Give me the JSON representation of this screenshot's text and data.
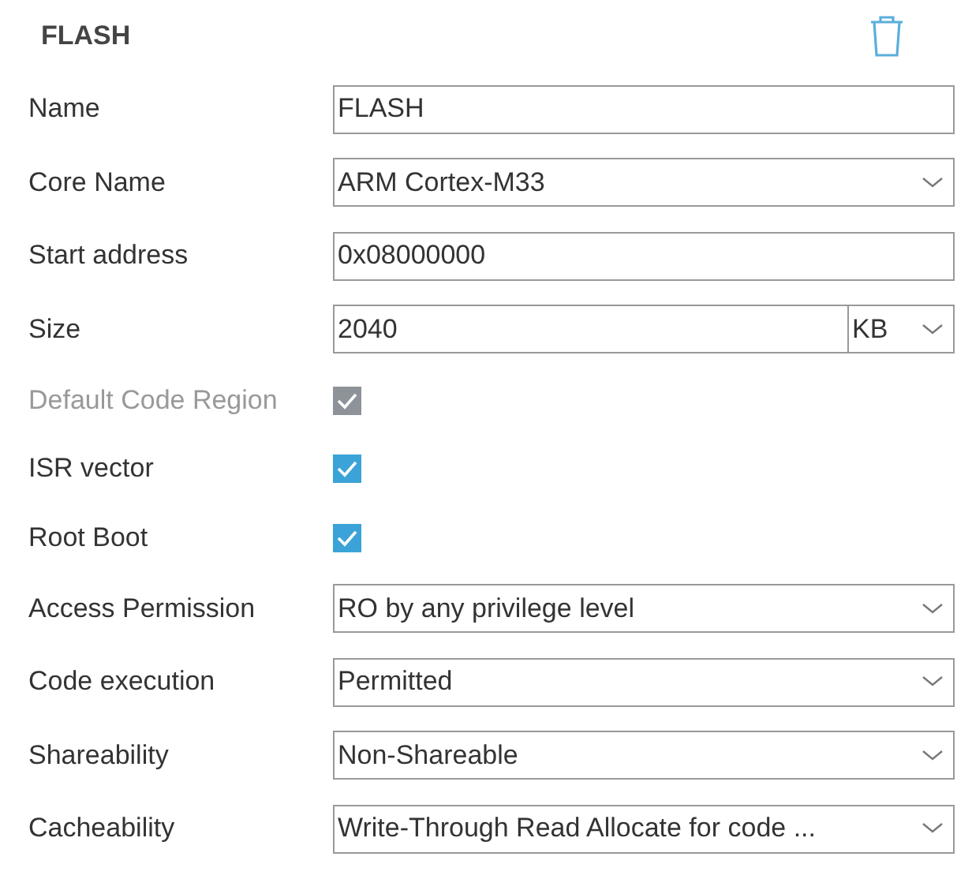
{
  "panel": {
    "title": "FLASH"
  },
  "fields": [
    {
      "kind": "text",
      "label": "Name",
      "value": "FLASH"
    },
    {
      "kind": "select",
      "label": "Core Name",
      "value": "ARM Cortex-M33"
    },
    {
      "kind": "text",
      "label": "Start address",
      "value": "0x08000000"
    },
    {
      "kind": "size",
      "label": "Size",
      "value": "2040",
      "unit": "KB"
    },
    {
      "kind": "checkbox",
      "label": "Default Code Region",
      "checked": true,
      "disabled": true
    },
    {
      "kind": "checkbox",
      "label": "ISR vector",
      "checked": true,
      "disabled": false
    },
    {
      "kind": "checkbox",
      "label": "Root Boot",
      "checked": true,
      "disabled": false
    },
    {
      "kind": "select",
      "label": "Access Permission",
      "value": "RO by any privilege level"
    },
    {
      "kind": "select",
      "label": "Code execution",
      "value": "Permitted"
    },
    {
      "kind": "select",
      "label": "Shareability",
      "value": "Non-Shareable"
    },
    {
      "kind": "select",
      "label": "Cacheability",
      "value": "Write-Through Read Allocate for code ..."
    }
  ]
}
